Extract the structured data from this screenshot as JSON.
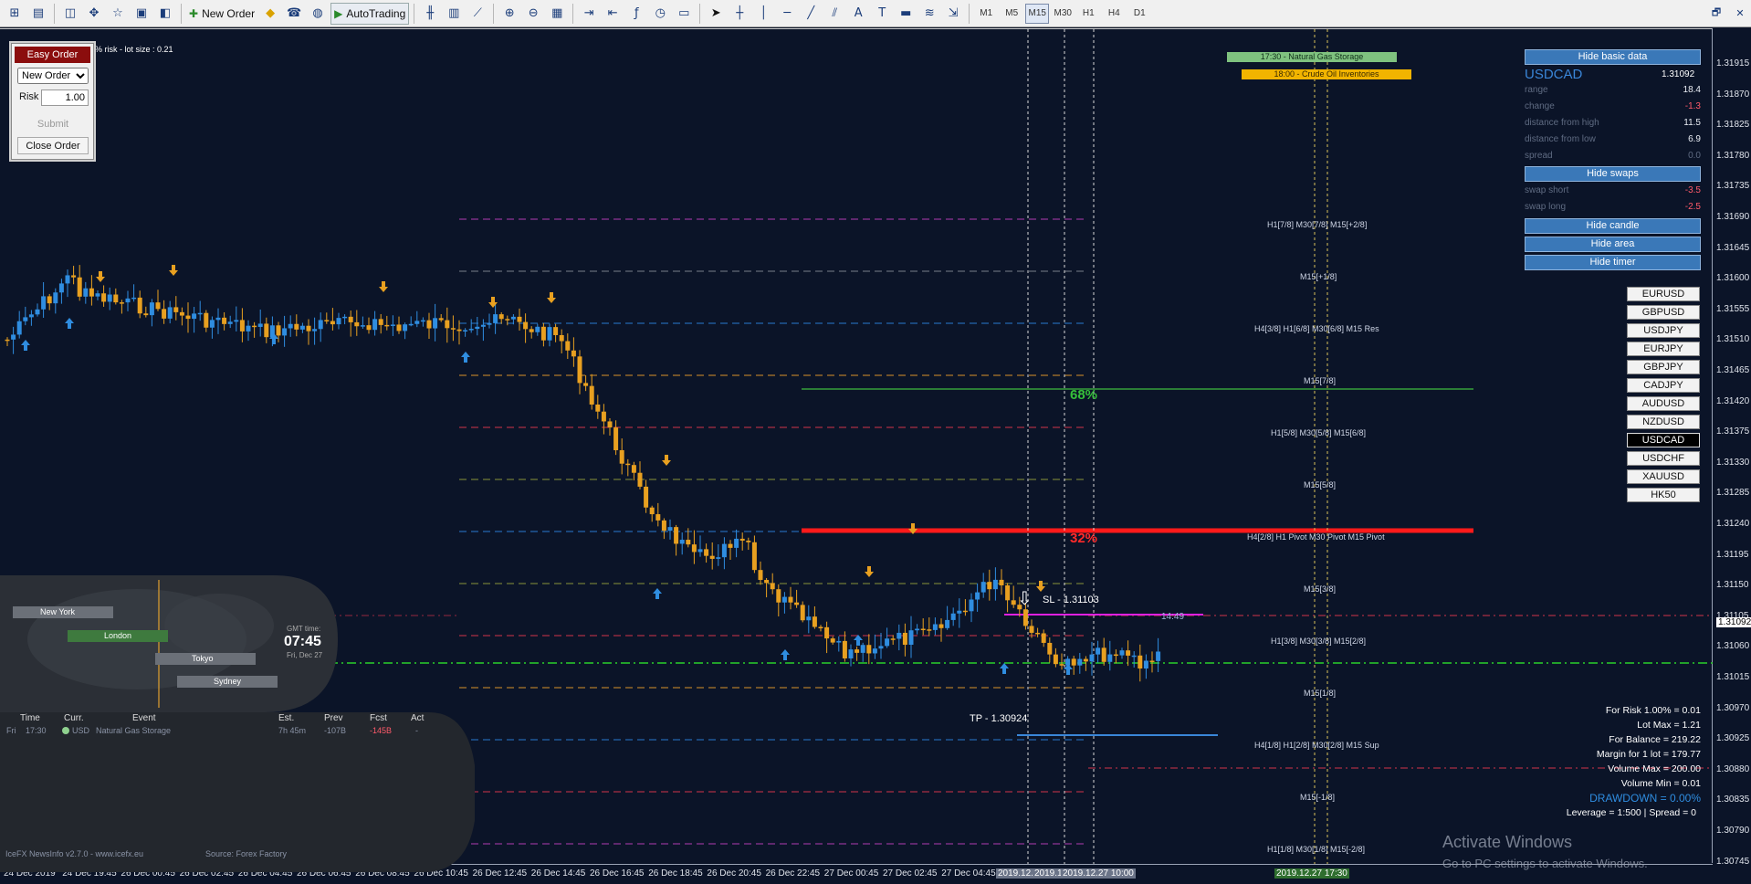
{
  "toolbar": {
    "new_order": "New Order",
    "autotrading": "AutoTrading",
    "timeframes": [
      "M1",
      "M5",
      "M15",
      "M30",
      "H1",
      "H4",
      "D1"
    ],
    "active_timeframe": "M15"
  },
  "easy_order": {
    "title": "Easy Order",
    "order_type": "New Order",
    "risk_label": "Risk",
    "risk_value": "1.00",
    "submit": "Submit",
    "close": "Close Order",
    "caption": "% risk - lot size : 0.21"
  },
  "info_panel": {
    "hide_basic": "Hide basic data",
    "symbol": "USDCAD",
    "price": "1.31092",
    "rows": [
      {
        "label": "range",
        "value": "18.4",
        "neg": false
      },
      {
        "label": "change",
        "value": "-1.3",
        "neg": true
      },
      {
        "label": "distance from high",
        "value": "11.5",
        "neg": false
      },
      {
        "label": "distance from low",
        "value": "6.9",
        "neg": false
      },
      {
        "label": "spread",
        "value": "0.0",
        "neg": false
      }
    ],
    "hide_swaps": "Hide swaps",
    "swaps": [
      {
        "label": "swap short",
        "value": "-3.5",
        "neg": true
      },
      {
        "label": "swap long",
        "value": "-2.5",
        "neg": true
      }
    ],
    "hide_candle": "Hide candle",
    "hide_area": "Hide area",
    "hide_timer": "Hide timer"
  },
  "pairs": [
    "EURUSD",
    "GBPUSD",
    "USDJPY",
    "EURJPY",
    "GBPJPY",
    "CADJPY",
    "AUDUSD",
    "NZDUSD",
    "USDCAD",
    "USDCHF",
    "XAUUSD",
    "HK50"
  ],
  "selected_pair": "USDCAD",
  "events": [
    {
      "text": "17:30 - Natural Gas Storage",
      "bg": "#7fc27f",
      "color": "#10301a"
    },
    {
      "text": "18:00 - Crude Oil Inventories",
      "bg": "#f2b400",
      "color": "#3a2a00"
    }
  ],
  "levels": [
    {
      "text": "H1[7/8] M30[7/8] M15[+2/8]",
      "color": "#d23bd2"
    },
    {
      "text": "M15[+1/8]",
      "color": "#8a8f9a"
    },
    {
      "text": "H4[3/8] H1[6/8] M30[6/8] M15 Res",
      "color": "#2f8de0"
    },
    {
      "text": "M15[7/8]",
      "color": "#e39a2a"
    },
    {
      "text": "H1[5/8] M30[5/8] M15[6/8]",
      "color": "#e0334a"
    },
    {
      "text": "M15[5/8]",
      "color": "#9aa33a"
    },
    {
      "text": "H4[2/8] H1 Pivot M30 Pivot M15 Pivot",
      "color": "#2f8de0"
    },
    {
      "text": "M15[3/8]",
      "color": "#9aa33a"
    },
    {
      "text": "H1[3/8] M30[3/8] M15[2/8]",
      "color": "#e0334a"
    },
    {
      "text": "M15[1/8]",
      "color": "#e39a2a"
    },
    {
      "text": "H4[1/8] H1[2/8] M30[2/8] M15 Sup",
      "color": "#2f8de0"
    },
    {
      "text": "M15[-1/8]",
      "color": "#8a8f9a"
    },
    {
      "text": "H1[1/8] M30[1/8] M15[-2/8]",
      "color": "#d23bd2"
    }
  ],
  "annotations": {
    "pct_top": "68%",
    "pct_bottom": "32%",
    "sl": "SL - 1.31103",
    "tp": "TP - 1.30924",
    "timer": "14:49"
  },
  "stats": [
    "For Risk 1.00% = 0.01",
    "Lot Max = 1.21",
    "For Balance = 219.22",
    "Margin for 1 lot = 179.77",
    "Volume Max = 200.00",
    "Volume Min = 0.01",
    "DRAWDOWN = 0.00%",
    "Leverage = 1:500 | Spread = 0"
  ],
  "news": {
    "cities": [
      "New York",
      "London",
      "Tokyo",
      "Sydney"
    ],
    "gmt_label": "GMT time:",
    "gmt_time": "07:45",
    "gmt_date": "Fri, Dec 27",
    "headers": [
      "Time",
      "Curr.",
      "Event",
      "Est.",
      "Prev",
      "Fcst",
      "Act"
    ],
    "row": {
      "day": "Fri",
      "time": "17:30",
      "curr": "USD",
      "event": "Natural Gas Storage",
      "est": "7h 45m",
      "prev": "-107B",
      "fcst": "-145B",
      "act": "-"
    },
    "footer_left": "IceFX NewsInfo v2.7.0 - www.icefx.eu",
    "footer_right": "Source: Forex Factory"
  },
  "y_axis": [
    "1.31915",
    "1.31870",
    "1.31825",
    "1.31780",
    "1.31735",
    "1.31690",
    "1.31645",
    "1.31600",
    "1.31555",
    "1.31510",
    "1.31465",
    "1.31420",
    "1.31375",
    "1.31330",
    "1.31285",
    "1.31240",
    "1.31195",
    "1.31150",
    "1.31105",
    "1.31060",
    "1.31015",
    "1.30970",
    "1.30925",
    "1.30880",
    "1.30835",
    "1.30790",
    "1.30745"
  ],
  "current_price_label": "1.31092",
  "x_axis": [
    "24 Dec 2019",
    "24 Dec 19:45",
    "26 Dec 00:45",
    "26 Dec 02:45",
    "26 Dec 04:45",
    "26 Dec 06:45",
    "26 Dec 08:45",
    "26 Dec 10:45",
    "26 Dec 12:45",
    "26 Dec 14:45",
    "26 Dec 16:45",
    "26 Dec 18:45",
    "26 Dec 20:45",
    "26 Dec 22:45",
    "27 Dec 00:45",
    "27 Dec 02:45",
    "27 Dec 04:45"
  ],
  "x_highlight": [
    "2019.12.",
    "2019.1",
    "2019.12.27 10:00"
  ],
  "x_event": "2019.12.27 17:30",
  "watermark": {
    "title": "Activate Windows",
    "sub": "Go to PC settings to activate Windows."
  }
}
